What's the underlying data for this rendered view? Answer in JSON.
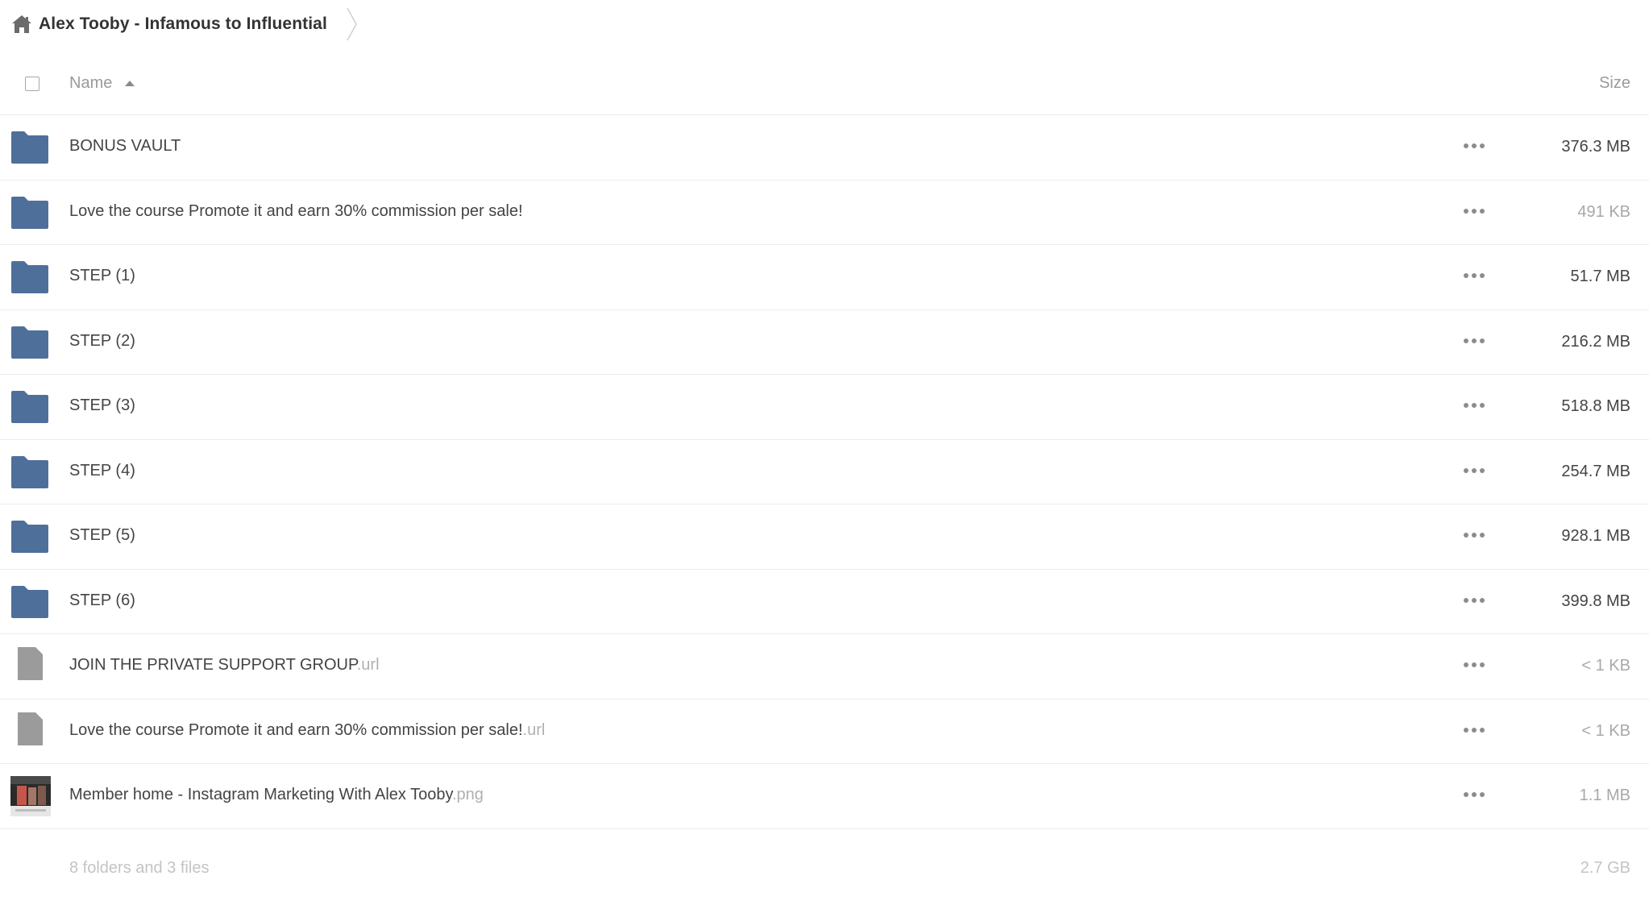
{
  "breadcrumb": {
    "home_icon": "home-icon",
    "title": "Alex Tooby - Infamous to Influential"
  },
  "header": {
    "name_label": "Name",
    "size_label": "Size",
    "sort": "ascending"
  },
  "rows": [
    {
      "type": "folder",
      "icon": "folder-icon",
      "name": "BONUS VAULT",
      "ext": "",
      "size": "376.3 MB",
      "size_muted": false
    },
    {
      "type": "folder",
      "icon": "folder-icon",
      "name": "Love the course Promote it and earn 30% commission per sale!",
      "ext": "",
      "size": "491 KB",
      "size_muted": true
    },
    {
      "type": "folder",
      "icon": "folder-icon",
      "name": "STEP (1)",
      "ext": "",
      "size": "51.7 MB",
      "size_muted": false
    },
    {
      "type": "folder",
      "icon": "folder-icon",
      "name": "STEP (2)",
      "ext": "",
      "size": "216.2 MB",
      "size_muted": false
    },
    {
      "type": "folder",
      "icon": "folder-icon",
      "name": "STEP (3)",
      "ext": "",
      "size": "518.8 MB",
      "size_muted": false
    },
    {
      "type": "folder",
      "icon": "folder-icon",
      "name": "STEP (4)",
      "ext": "",
      "size": "254.7 MB",
      "size_muted": false
    },
    {
      "type": "folder",
      "icon": "folder-icon",
      "name": "STEP (5)",
      "ext": "",
      "size": "928.1 MB",
      "size_muted": false
    },
    {
      "type": "folder",
      "icon": "folder-icon",
      "name": "STEP (6)",
      "ext": "",
      "size": "399.8 MB",
      "size_muted": false
    },
    {
      "type": "file",
      "icon": "file-icon",
      "name": "JOIN THE PRIVATE SUPPORT GROUP",
      "ext": ".url",
      "size": "< 1 KB",
      "size_muted": true
    },
    {
      "type": "file",
      "icon": "file-icon",
      "name": "Love the course Promote it and earn 30% commission per sale!",
      "ext": ".url",
      "size": "< 1 KB",
      "size_muted": true
    },
    {
      "type": "image",
      "icon": "image-thumbnail",
      "name": "Member home - Instagram Marketing With Alex Tooby",
      "ext": ".png",
      "size": "1.1 MB",
      "size_muted": true
    }
  ],
  "footer": {
    "summary": "8 folders and 3 files",
    "total_size": "2.7 GB"
  },
  "colors": {
    "folder": "#4f6f9b",
    "file": "#9b9b9b",
    "divider": "#ececec",
    "muted_text": "#a8a8a8"
  }
}
